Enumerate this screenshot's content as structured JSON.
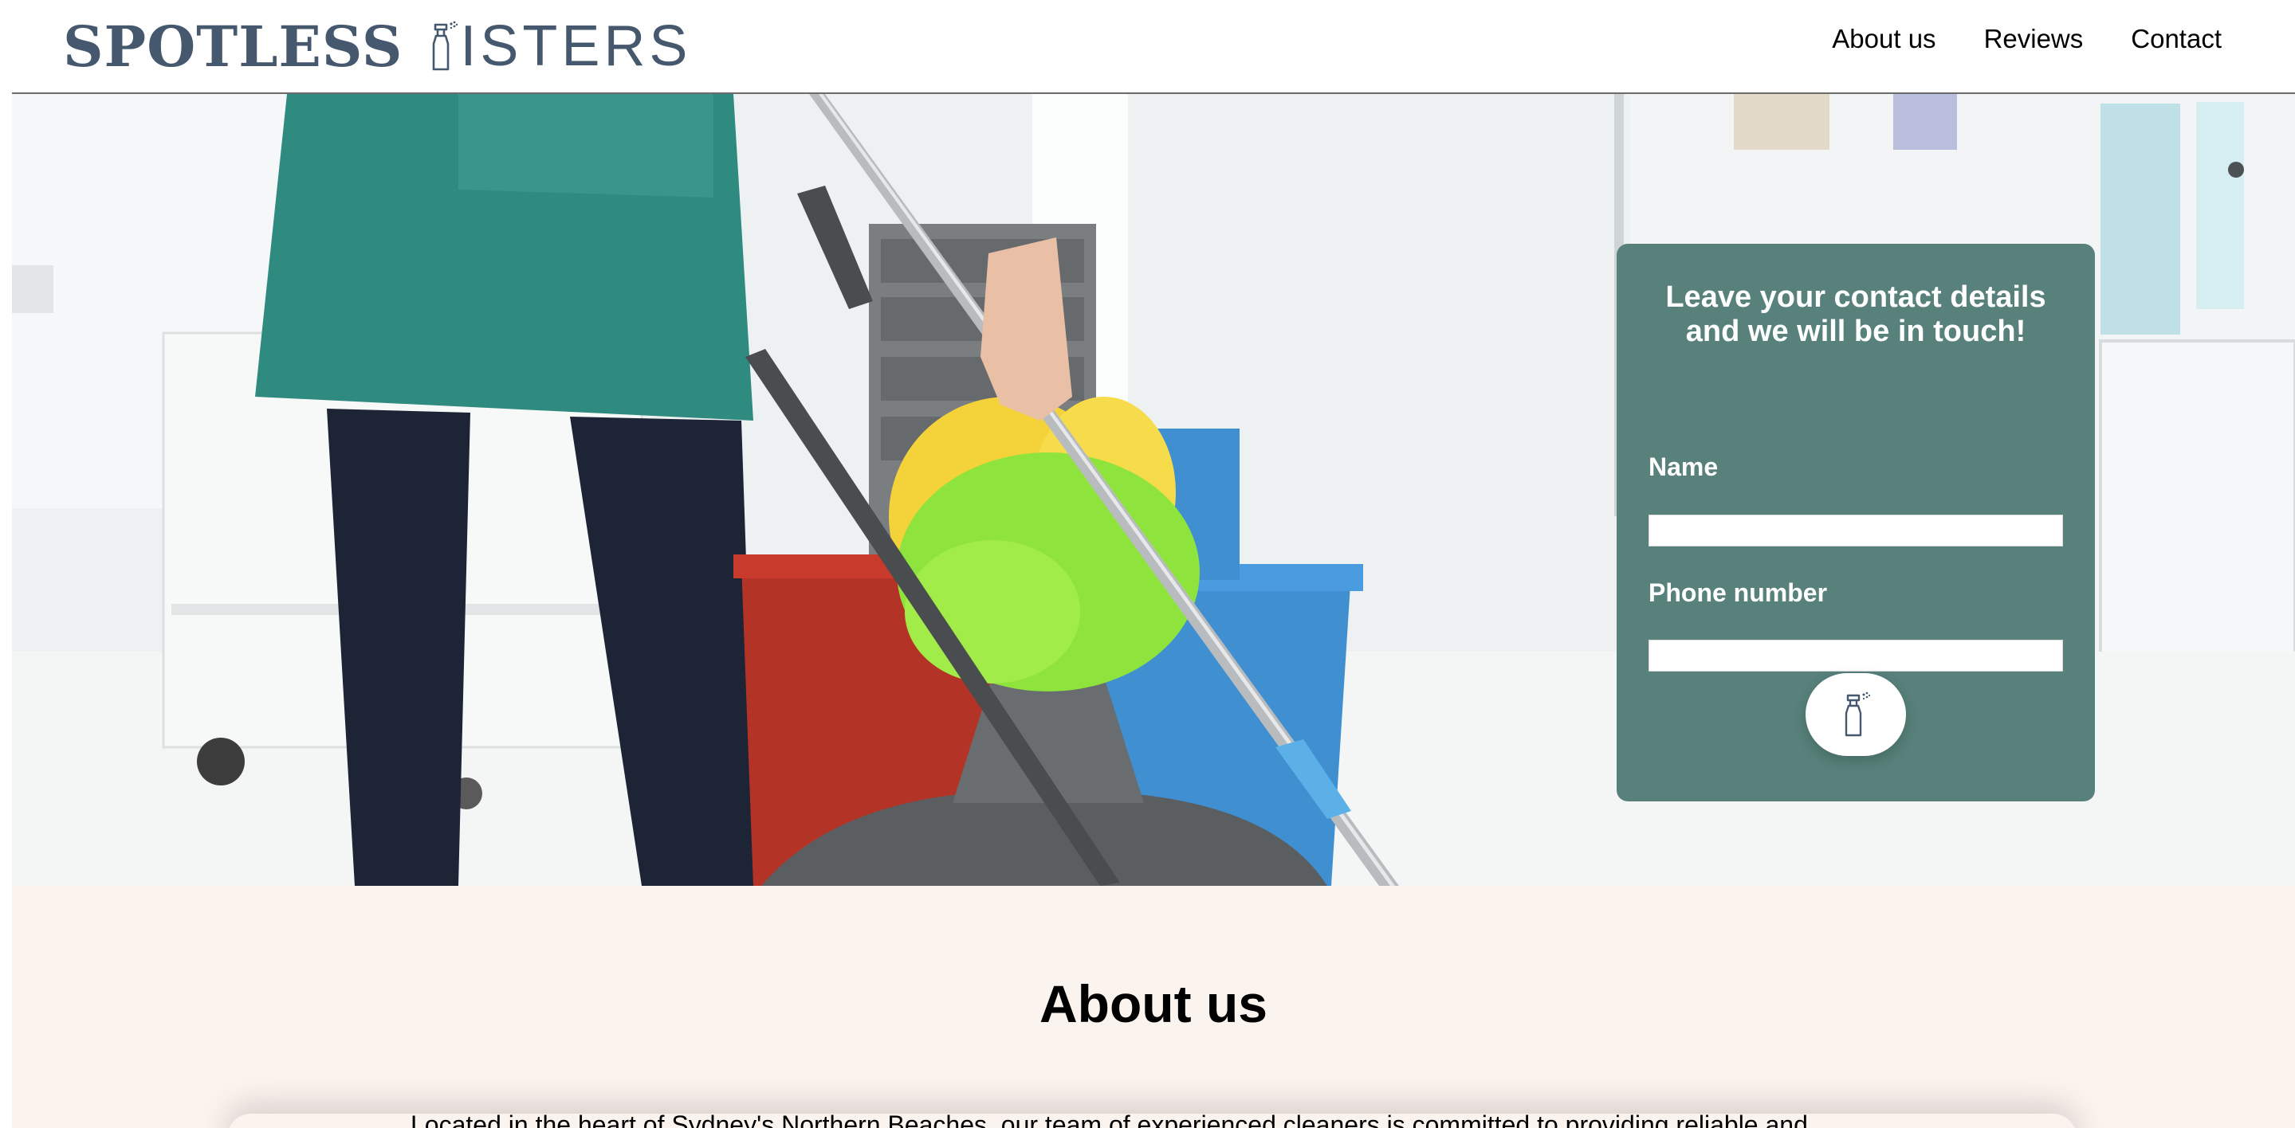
{
  "header": {
    "logo_bold": "SPOTLESS",
    "logo_light": "ISTERS",
    "nav": [
      {
        "label": "About us"
      },
      {
        "label": "Reviews"
      },
      {
        "label": "Contact"
      }
    ]
  },
  "contact_form": {
    "title": "Leave your contact details\nand we will be in touch!",
    "name_label": "Name",
    "name_value": "",
    "phone_label": "Phone number",
    "phone_value": "",
    "submit_icon": "spray-bottle-icon"
  },
  "about": {
    "title": "About us",
    "text": "Located in the heart of Sydney's Northern Beaches, our team of experienced cleaners is committed to providing reliable and"
  },
  "colors": {
    "brand_navy": "#46586e",
    "card_green": "#57817a",
    "about_bg": "#fbf3ee"
  }
}
